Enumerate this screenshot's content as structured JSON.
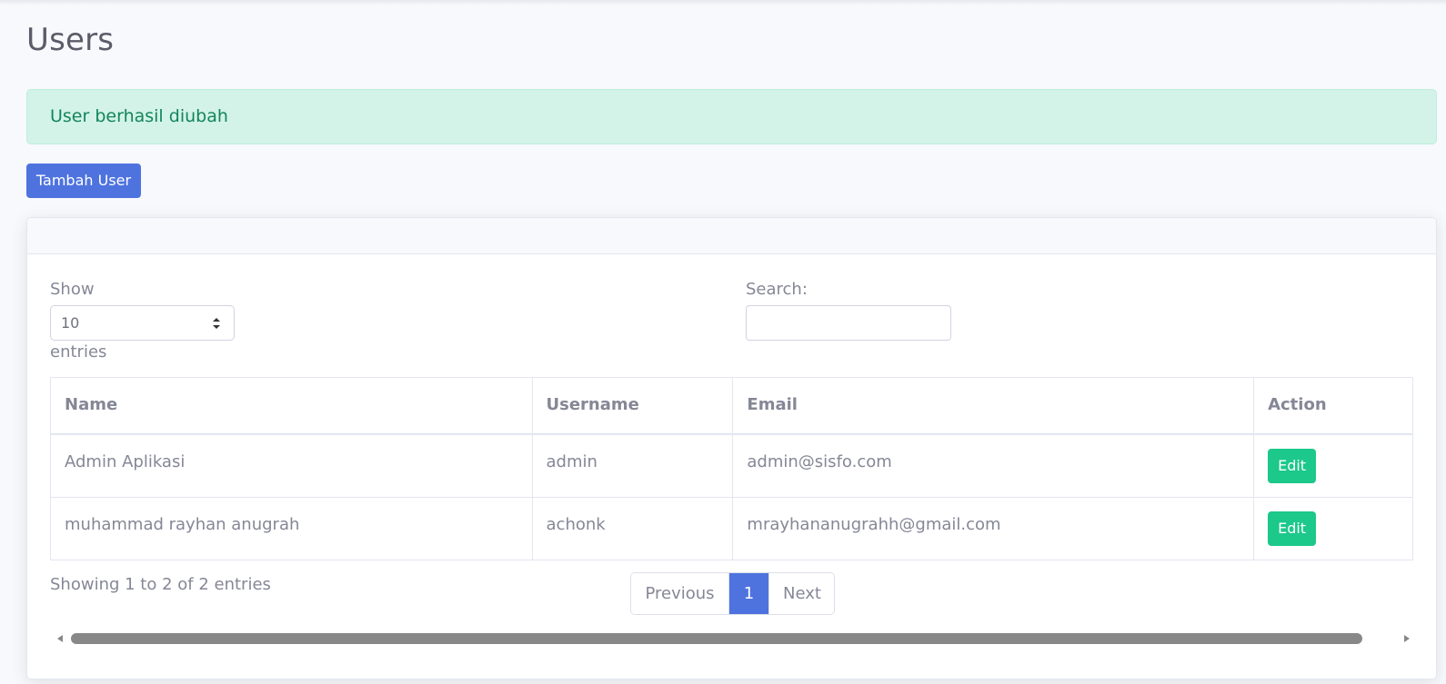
{
  "page": {
    "title": "Users"
  },
  "alert": {
    "message": "User berhasil diubah"
  },
  "toolbar": {
    "add_label": "Tambah User"
  },
  "datatable": {
    "length_label": "Show",
    "length_value": "10",
    "length_suffix": "entries",
    "search_label": "Search:",
    "search_value": "",
    "columns": [
      "Name",
      "Username",
      "Email",
      "Action"
    ],
    "rows": [
      {
        "name": "Admin Aplikasi",
        "username": "admin",
        "email": "admin@sisfo.com",
        "action": "Edit"
      },
      {
        "name": "muhammad rayhan anugrah",
        "username": "achonk",
        "email": "mrayhananugrahh@gmail.com",
        "action": "Edit"
      }
    ],
    "info": "Showing 1 to 2 of 2 entries",
    "pagination": {
      "previous": "Previous",
      "current": "1",
      "next": "Next"
    }
  },
  "colors": {
    "primary": "#4e73df",
    "success": "#1cc88a",
    "alert_bg": "#d3f3e8",
    "alert_text": "#13855c"
  },
  "icons": {
    "select_arrows": "sort-arrows-icon"
  }
}
